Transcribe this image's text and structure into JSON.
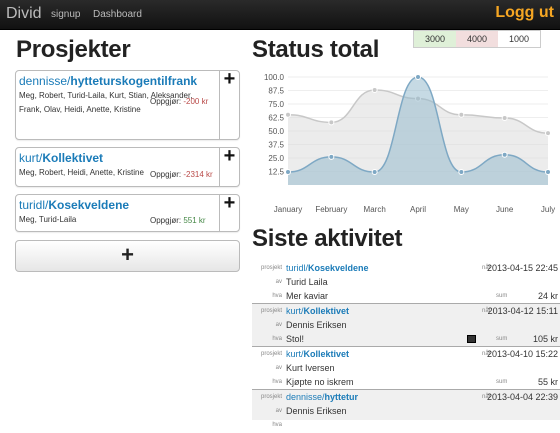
{
  "navbar": {
    "brand": "Divid",
    "links": [
      "signup",
      "Dashboard"
    ],
    "logout": "Logg ut"
  },
  "projects_title": "Prosjekter",
  "projects": [
    {
      "owner": "dennisse",
      "name": "hytteturskogentilfrank",
      "members": "Meg, Robert, Turid-Laila, Kurt, Stian, Aleksander, Frank, Olav, Heidi, Anette, Kristine",
      "settlement_label": "Oppgjør:",
      "settlement": "-200 kr",
      "sign": "neg"
    },
    {
      "owner": "kurt",
      "name": "Kollektivet",
      "members": "Meg, Robert, Heidi, Anette, Kristine",
      "settlement_label": "Oppgjør:",
      "settlement": "-2314 kr",
      "sign": "neg"
    },
    {
      "owner": "turidl",
      "name": "Kosekveldene",
      "members": "Meg, Turid-Laila",
      "settlement_label": "Oppgjør:",
      "settlement": "551 kr",
      "sign": "pos"
    }
  ],
  "add_project": "+",
  "status_title": "Status total",
  "legend": [
    {
      "label": "3000",
      "color": "#dff0d8"
    },
    {
      "label": "4000",
      "color": "#f2dede"
    },
    {
      "label": "1000",
      "color": "#ffffff"
    }
  ],
  "chart_data": {
    "type": "area",
    "categories": [
      "January",
      "February",
      "March",
      "April",
      "May",
      "June",
      "July"
    ],
    "y_ticks": [
      "100.0",
      "87.5",
      "75.0",
      "62.5",
      "50.0",
      "37.5",
      "25.0",
      "12.5"
    ],
    "ylim": [
      0,
      100
    ],
    "series": [
      {
        "values": [
          65,
          58,
          88,
          80,
          65,
          62,
          48
        ],
        "color": "#d8d8d8"
      },
      {
        "values": [
          12,
          26,
          12,
          100,
          12,
          28,
          12
        ],
        "color": "#a9c6d8"
      }
    ]
  },
  "activity_title": "Siste aktivitet",
  "activity_labels": {
    "project": "prosjekt",
    "by": "av",
    "what": "hva",
    "date": "når",
    "sum": "sum"
  },
  "activities": [
    {
      "owner": "turidl",
      "project": "Kosekveldene",
      "date": "2013-04-15 22:45",
      "by": "Turid Laila",
      "what": "Mer kaviar",
      "sum": "24 kr",
      "image": false
    },
    {
      "owner": "kurt",
      "project": "Kollektivet",
      "date": "2013-04-12 15:11",
      "by": "Dennis Eriksen",
      "what": "Stol!",
      "sum": "105 kr",
      "image": true
    },
    {
      "owner": "kurt",
      "project": "Kollektivet",
      "date": "2013-04-10 15:22",
      "by": "Kurt Iversen",
      "what": "Kjøpte no iskrem",
      "sum": "55 kr",
      "image": false
    },
    {
      "owner": "dennisse",
      "project": "hyttetur",
      "date": "2013-04-04 22:39",
      "by": "Dennis Eriksen",
      "what": "",
      "sum": "",
      "image": false
    }
  ]
}
